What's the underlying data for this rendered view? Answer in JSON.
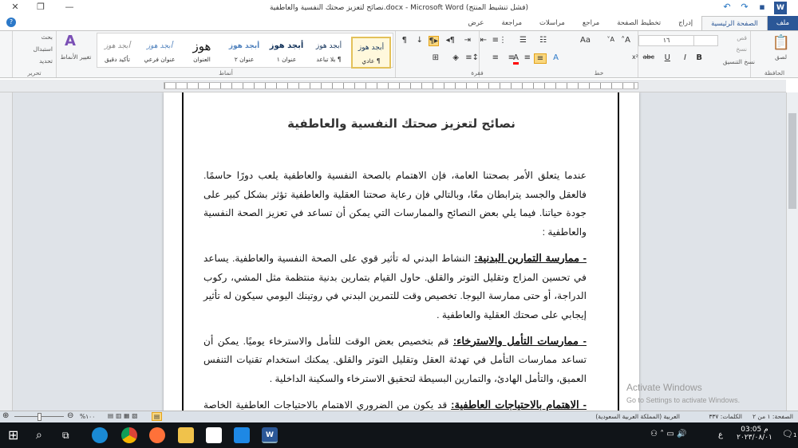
{
  "window": {
    "title": "نصائح لتعزيز صحتك النفسية والعاطفية.docx - Microsoft Word (فشل تنشيط المنتج)"
  },
  "tabs": [
    "ملف",
    "الصفحة الرئيسية",
    "إدراج",
    "تخطيط الصفحة",
    "مراجع",
    "مراسلات",
    "مراجعة",
    "عرض"
  ],
  "ribbon": {
    "clipboard": {
      "label": "الحافظة",
      "paste": "لصق",
      "cut": "قص",
      "copy": "نسخ",
      "format_painter": "نسخ التنسيق"
    },
    "font": {
      "label": "خط",
      "name": "Arial",
      "size": "١٦"
    },
    "paragraph": {
      "label": "فقرة"
    },
    "styles": {
      "label": "أنماط",
      "items": [
        {
          "sample": "أبجد هوز",
          "name": "¶ عادي"
        },
        {
          "sample": "أبجد هوز",
          "name": "¶ بلا تباعد"
        },
        {
          "sample": "أبجد هوز",
          "name": "عنوان ١"
        },
        {
          "sample": "أبجد هوز",
          "name": "عنوان ٢"
        },
        {
          "sample": "هوز",
          "name": "العنوان"
        },
        {
          "sample": "أبجد هوز",
          "name": "عنوان فرعي"
        },
        {
          "sample": "أبجد هوز",
          "name": "تأكيد دقيق"
        }
      ],
      "change": "تغيير الأنماط"
    },
    "editing": {
      "label": "تحرير",
      "find": "بحث",
      "replace": "استبدال",
      "select": "تحديد"
    }
  },
  "document": {
    "title": "نصائح لتعزيز صحتك النفسية والعاطفية",
    "intro": "عندما يتعلق الأمر بصحتنا العامة، فإن الاهتمام بالصحة النفسية والعاطفية يلعب دورًا حاسمًا. فالعقل والجسد يترابطان معًا، وبالتالي فإن رعاية صحتنا العقلية والعاطفية تؤثر بشكل كبير على جودة حياتنا. فيما يلي بعض النصائح والممارسات التي يمكن أن تساعد في تعزيز الصحة النفسية والعاطفية :",
    "sections": [
      {
        "heading": "- ممارسة التمارين البدنية:",
        "text": " النشاط البدني له تأثير قوي على الصحة النفسية والعاطفية. يساعد في تحسين المزاج وتقليل التوتر والقلق. حاول القيام بتمارين بدنية منتظمة مثل المشي، ركوب الدراجة، أو حتى ممارسة اليوجا. تخصيص وقت للتمرين البدني في روتينك اليومي سيكون له تأثير إيجابي على صحتك العقلية والعاطفية ."
      },
      {
        "heading": "- ممارسات التأمل والاسترخاء:",
        "text": " قم بتخصيص بعض الوقت للتأمل والاسترخاء يوميًا. يمكن أن تساعد ممارسات التأمل في تهدئة العقل وتقليل التوتر والقلق. يمكنك استخدام تقنيات التنفس العميق، والتأمل الهادئ، والتمارين البسيطة لتحقيق الاسترخاء والسكينة الداخلية ."
      },
      {
        "heading": "- الاهتمام بالاحتياجات العاطفية:",
        "text": " قد يكون من الضروري الاهتمام بالاحتياجات العاطفية الخاصة بك. حاول التعرف على ما يجعلك سعيدًا ومرتاحًا وقم بتلبية تلك الاحتياجات بانتظام."
      }
    ]
  },
  "watermark": {
    "line1": "Activate Windows",
    "line2": "Go to Settings to activate Windows."
  },
  "status": {
    "page": "الصفحة: ١ من ٢",
    "words": "الكلمات: ٣٣٧",
    "language": "العربية (المملكة العربية السعودية)",
    "zoom": "%١٠٠"
  },
  "taskbar": {
    "time": "03:05 م",
    "date": "٢٠٢٣/٠٨/٠١",
    "lang": "ع",
    "notifications": "1"
  }
}
